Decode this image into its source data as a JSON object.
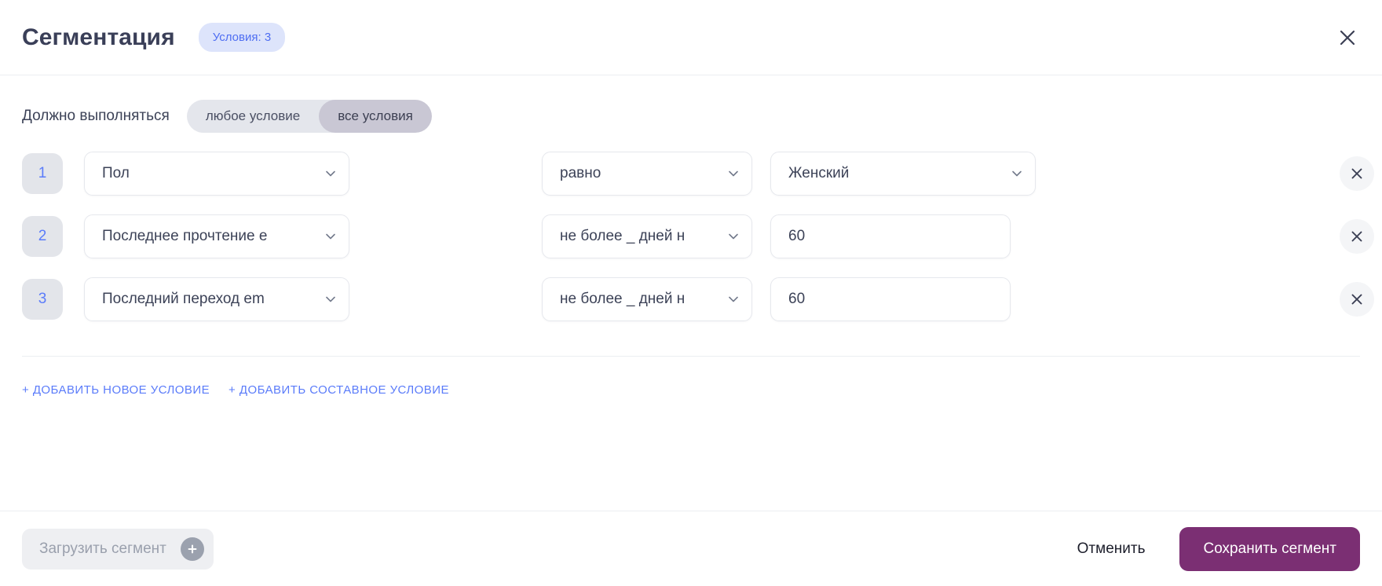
{
  "header": {
    "title": "Сегментация",
    "badge": "Условия: 3",
    "close_icon": "close-icon"
  },
  "match": {
    "label": "Должно выполняться",
    "options": [
      {
        "label": "любое условие",
        "active": false
      },
      {
        "label": "все условия",
        "active": true
      }
    ]
  },
  "conditions": [
    {
      "index": "1",
      "attribute": "Пол",
      "operator": "равно",
      "value": "Женский",
      "value_type": "select"
    },
    {
      "index": "2",
      "attribute": "Последнее прочтение е",
      "operator": "не более _ дней н",
      "value": "60",
      "value_type": "input"
    },
    {
      "index": "3",
      "attribute": "Последний переход em",
      "operator": "не более _ дней н",
      "value": "60",
      "value_type": "input"
    }
  ],
  "add_links": [
    {
      "label": "+ Добавить новое условие"
    },
    {
      "label": "+ Добавить составное условие"
    }
  ],
  "footer": {
    "load_segment": "Загрузить сегмент",
    "cancel": "Отменить",
    "save": "Сохранить сегмент"
  },
  "colors": {
    "accent_blue": "#5b7cfa",
    "badge_bg": "#dde4fb",
    "save_purple": "#7b2f73",
    "toggle_track": "#e4e6ec",
    "toggle_active": "#c9c7d4",
    "index_bg": "#e3e5ea",
    "text_primary": "#3c4257"
  }
}
